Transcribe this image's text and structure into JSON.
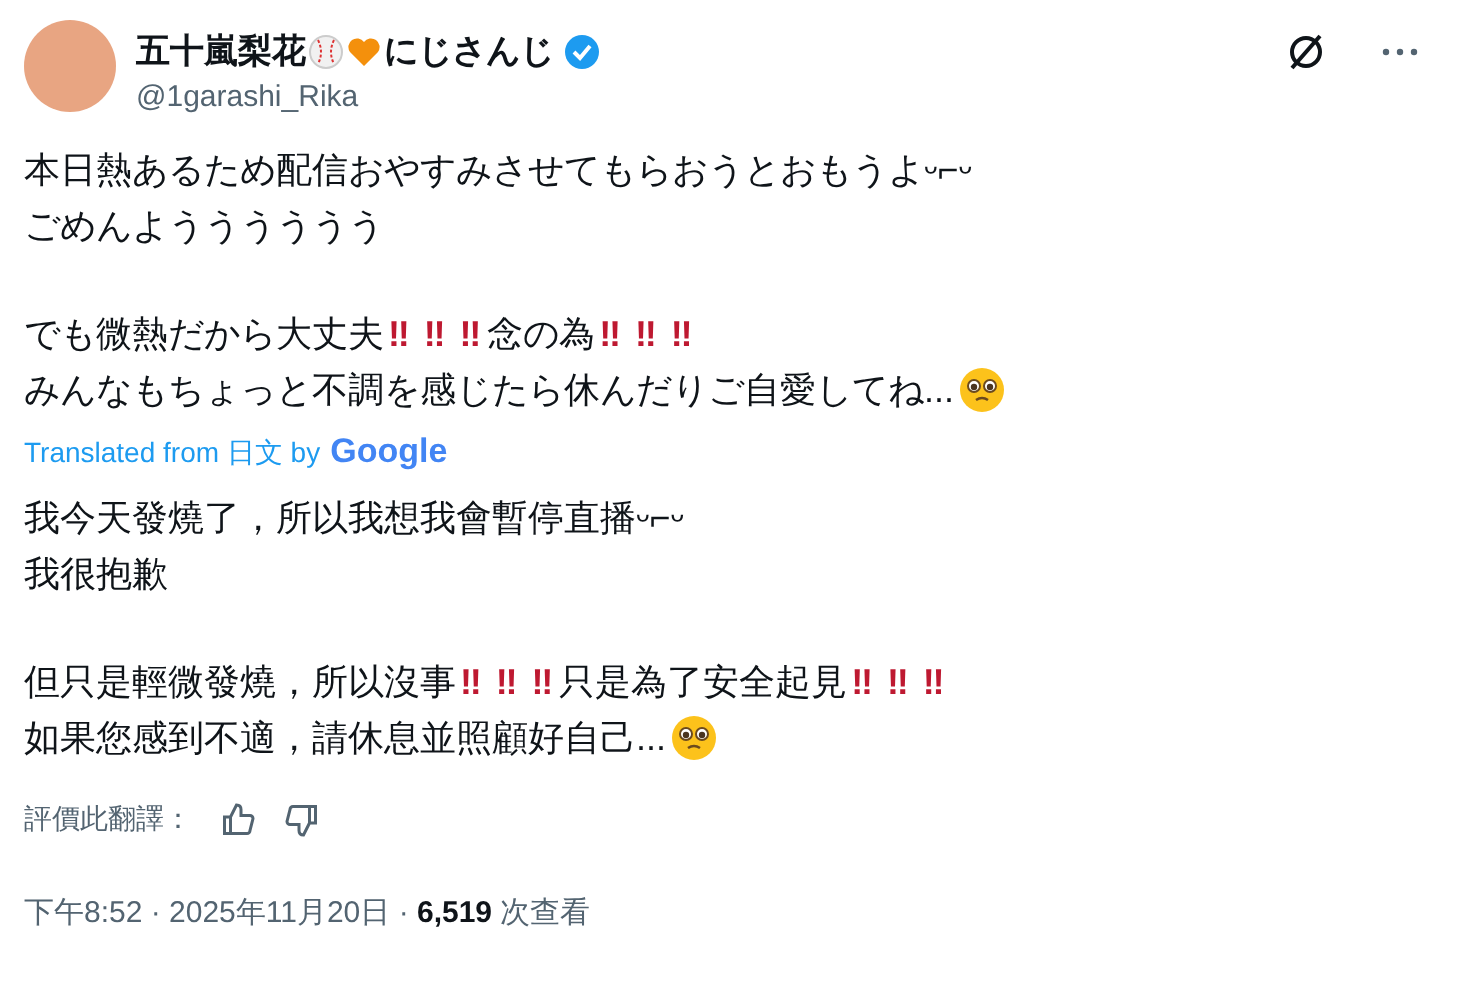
{
  "author": {
    "name_parts": [
      {
        "kind": "text",
        "text": "五十嵐梨花"
      },
      {
        "kind": "baseball"
      },
      {
        "kind": "heart"
      },
      {
        "kind": "text",
        "text": "にじさんじ"
      }
    ],
    "verified": true,
    "handle": "@1garashi_Rika"
  },
  "original": [
    {
      "kind": "line",
      "segments": [
        {
          "kind": "text",
          "text": "本日熱あるため配信おやすみさせてもらおうとおもうよᵕ⌐ᵕ"
        }
      ]
    },
    {
      "kind": "line",
      "segments": [
        {
          "kind": "text",
          "text": "ごめんようううううう"
        }
      ]
    },
    {
      "kind": "gap"
    },
    {
      "kind": "line",
      "segments": [
        {
          "kind": "text",
          "text": "でも微熱だから大丈夫"
        },
        {
          "kind": "alert",
          "text": "‼ ‼ ‼"
        },
        {
          "kind": "text",
          "text": "念の為"
        },
        {
          "kind": "alert",
          "text": "‼ ‼ ‼"
        }
      ]
    },
    {
      "kind": "line",
      "segments": [
        {
          "kind": "text",
          "text": "みんなもちょっと不調を感じたら休んだりご自愛してね..."
        },
        {
          "kind": "face"
        }
      ]
    }
  ],
  "translation_note": {
    "prefix": "Translated from 日文 by",
    "provider": "Google"
  },
  "translated": [
    {
      "kind": "line",
      "segments": [
        {
          "kind": "text",
          "text": "我今天發燒了，所以我想我會暫停直播ᵕ⌐ᵕ"
        }
      ]
    },
    {
      "kind": "line",
      "segments": [
        {
          "kind": "text",
          "text": "我很抱歉"
        }
      ]
    },
    {
      "kind": "gap"
    },
    {
      "kind": "line",
      "segments": [
        {
          "kind": "text",
          "text": "但只是輕微發燒，所以沒事"
        },
        {
          "kind": "alert",
          "text": "‼ ‼ ‼"
        },
        {
          "kind": "text",
          "text": "只是為了安全起見"
        },
        {
          "kind": "alert",
          "text": "‼ ‼ ‼"
        }
      ]
    },
    {
      "kind": "line",
      "segments": [
        {
          "kind": "text",
          "text": "如果您感到不適，請休息並照顧好自己... "
        },
        {
          "kind": "face"
        }
      ]
    }
  ],
  "rating_label": "評價此翻譯：",
  "meta": "下午8:52 · 2025年11月20日 · **6,519** 次查看"
}
